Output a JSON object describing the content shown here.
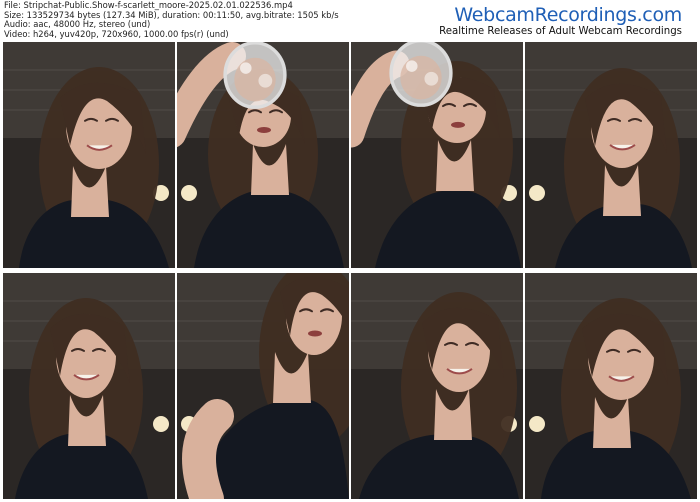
{
  "metadata": {
    "file_line": "File: Stripchat-Public.Show-f-scarlett_moore-2025.02.01.022536.mp4",
    "size_line": "Size: 133529734 bytes (127.34 MiB), duration: 00:11:50, avg.bitrate: 1505 kb/s",
    "audio_line": "Audio: aac, 48000 Hz, stereo (und)",
    "video_line": "Video: h264, yuv420p, 720x960, 1000.00 fps(r) (und)"
  },
  "brand": {
    "name": "WebcamRecordings.com",
    "tagline": "Realtime Releases of Adult Webcam Recordings"
  },
  "colors": {
    "brand_blue": "#1f5fb6",
    "background": "#ffffff",
    "room_dark": "#2b2725",
    "top_dark": "#47413c",
    "hair": "#3f2d22",
    "skin": "#d9b19c",
    "shirt": "#141821",
    "light": "#fff2d0"
  },
  "thumbnails": [
    {
      "pose": "smiling-center"
    },
    {
      "pose": "drinking-left"
    },
    {
      "pose": "drinking-right"
    },
    {
      "pose": "smiling-right"
    },
    {
      "pose": "smiling-left"
    },
    {
      "pose": "looking-up"
    },
    {
      "pose": "talking-center"
    },
    {
      "pose": "smiling-center"
    }
  ]
}
